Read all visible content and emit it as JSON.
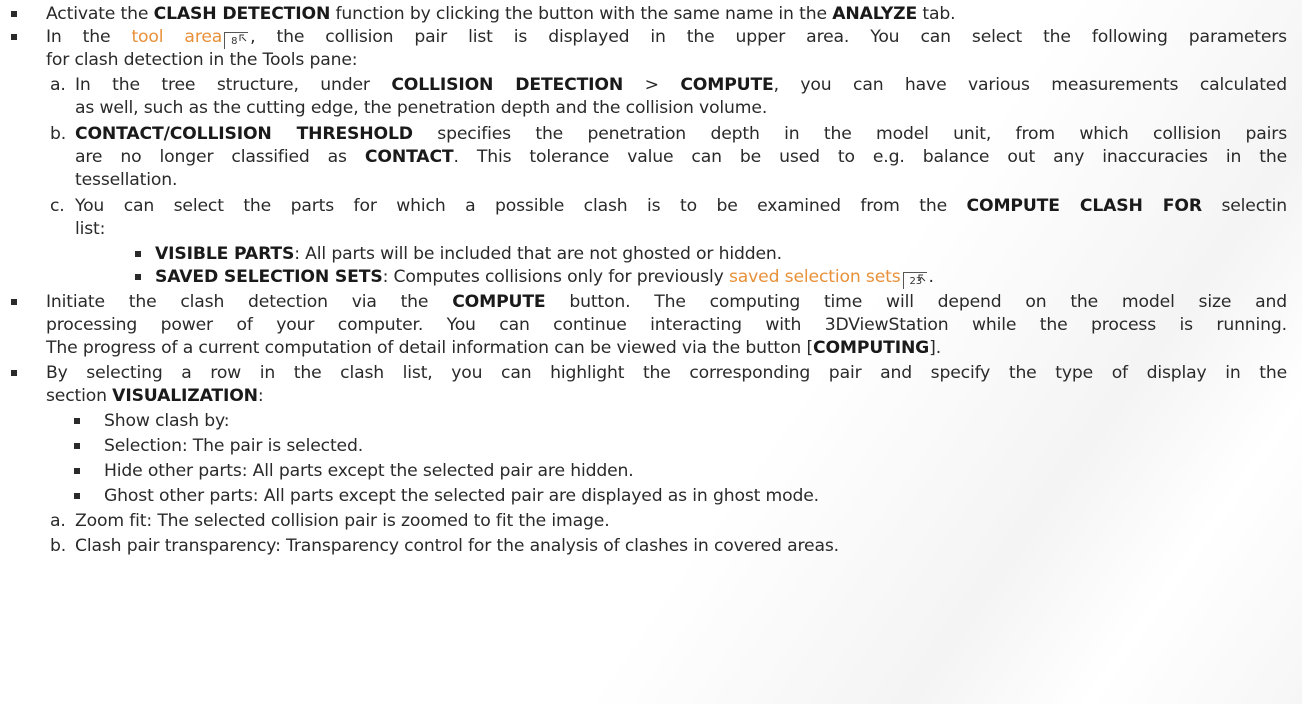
{
  "l1": {
    "a": "Activate the ",
    "b": "CLASH DETECTION",
    "c": " function by clicking the button with the same name in the ",
    "d": "ANALYZE",
    "e": " tab."
  },
  "l2": {
    "a": "In the ",
    "link": "tool area",
    "ref": "8",
    "b": ", the collision pair list is displayed in the upper area. You can select the following parameters"
  },
  "l3": "for clash detection in the Tools pane:",
  "l4": {
    "n": "a.",
    "a": "In the tree structure, under ",
    "b": "COLLISION DETECTION",
    "c": " > ",
    "d": "COMPUTE",
    "e": ", you can have various measurements calculated"
  },
  "l5": "as well, such as the cutting edge, the penetration depth and the collision volume.",
  "l6": {
    "n": "b.",
    "b": "CONTACT/COLLISION THRESHOLD",
    "a": " specifies the penetration depth in the model unit, from which collision pairs"
  },
  "l7": {
    "a": "are no longer classified as ",
    "b": "CONTACT",
    "c": ". This tolerance value can be used to e.g. balance out any inaccuracies in the"
  },
  "l8": "tessellation.",
  "l9": {
    "n": "c.",
    "a": "You can select the parts for which a possible clash is to be examined from the ",
    "b": "COMPUTE CLASH FOR",
    "c": " selectin"
  },
  "l10": "list:",
  "l11": {
    "b": "VISIBLE PARTS",
    "a": ": All parts will be included that are not ghosted or hidden."
  },
  "l12": {
    "b": "SAVED SELECTION SETS",
    "a": ": Computes collisions only for previously ",
    "link": "saved selection sets",
    "ref": "23",
    "c": "."
  },
  "l13": {
    "a": "Initiate the clash detection via the ",
    "b": "COMPUTE",
    "c": " button. The computing time will depend on the model size and"
  },
  "l14": "processing power of your computer. You can continue interacting with 3DViewStation while the process is running.",
  "l15": {
    "a": "The progress of a current computation of detail information can be viewed via the button [",
    "b": "COMPUTING",
    "c": "]."
  },
  "l16": "By selecting a row in the clash list, you can highlight the corresponding pair and specify the type of display in the",
  "l17": {
    "a": "section ",
    "b": "VISUALIZATION",
    "c": ":"
  },
  "l18": "Show clash by:",
  "l19": "Selection: The pair is selected.",
  "l20": "Hide other parts: All parts except the selected pair are hidden.",
  "l21": "Ghost other parts: All parts except the selected pair are displayed as in ghost mode.",
  "l22": {
    "n": "a.",
    "a": "Zoom fit: The selected collision pair is zoomed to fit the image."
  },
  "l23": {
    "n": "b.",
    "a": "Clash pair transparency: Transparency control for the analysis of clashes in covered areas."
  },
  "colors": {
    "text": "#2a2a2a",
    "link": "#e8913a",
    "background": "#ffffff"
  },
  "icons": [
    "bullet-square-icon",
    "topic-link-arrow-icon"
  ]
}
